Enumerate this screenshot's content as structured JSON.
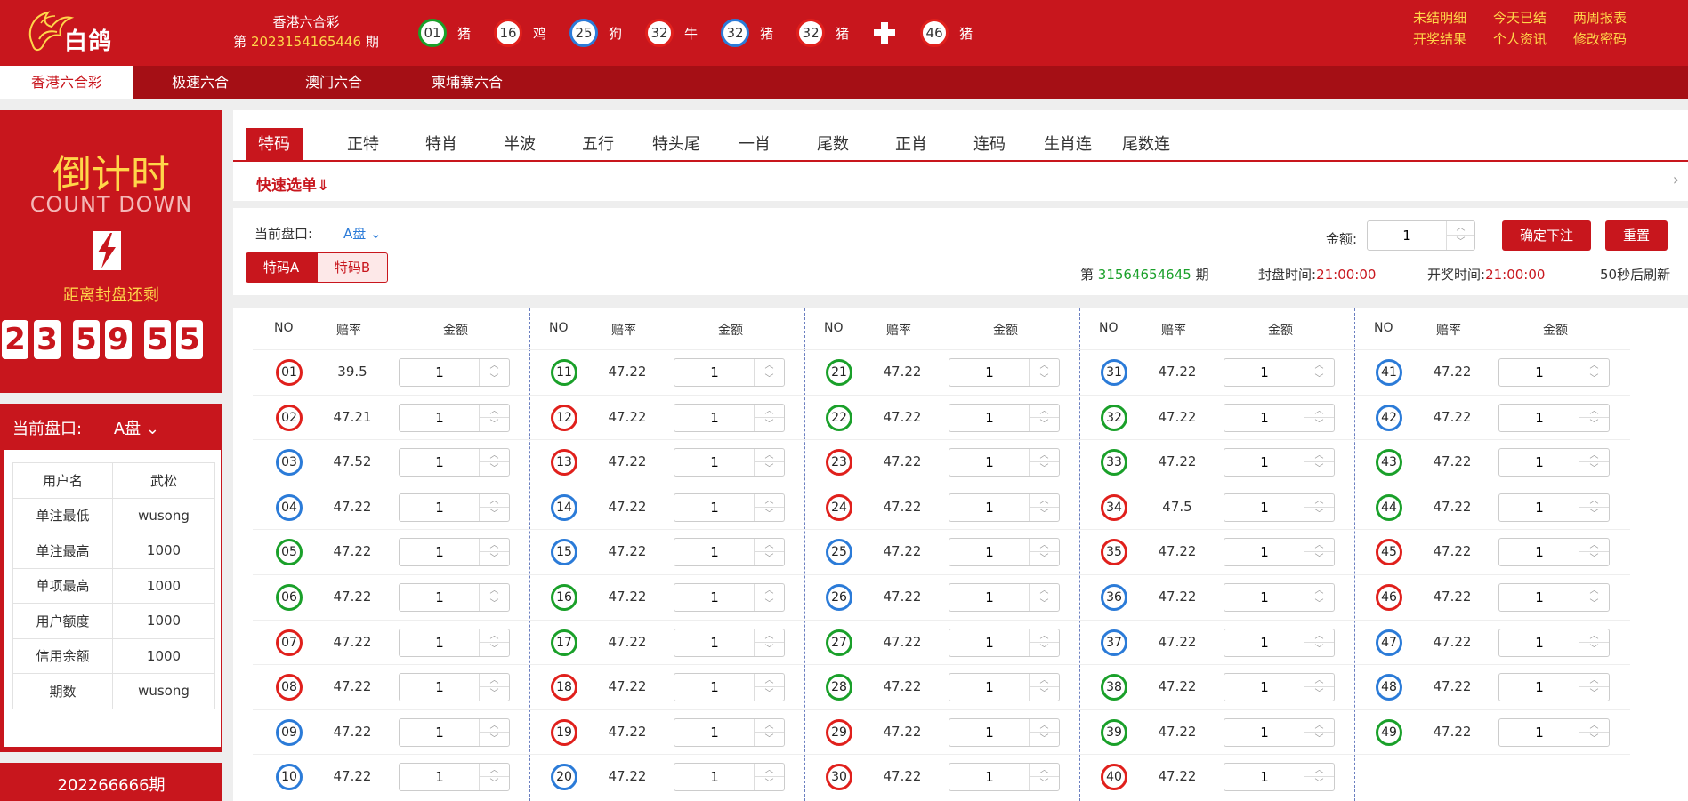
{
  "header": {
    "logo_text": "白鸽",
    "lottery_name": "香港六合彩",
    "period_prefix": "第",
    "period_number": "2023154165446",
    "period_suffix": "期",
    "draw": [
      {
        "num": "01",
        "zodiac": "猪",
        "color": "green"
      },
      {
        "num": "16",
        "zodiac": "鸡",
        "color": "red"
      },
      {
        "num": "25",
        "zodiac": "狗",
        "color": "blue"
      },
      {
        "num": "32",
        "zodiac": "牛",
        "color": "red"
      },
      {
        "num": "32",
        "zodiac": "猪",
        "color": "blue"
      },
      {
        "num": "32",
        "zodiac": "猪",
        "color": "red"
      },
      {
        "num": "46",
        "zodiac": "猪",
        "color": "red"
      }
    ],
    "links": [
      "未结明细",
      "今天已结",
      "两周报表",
      "开奖结果",
      "个人资讯",
      "修改密码"
    ]
  },
  "nav": [
    "香港六合彩",
    "极速六合",
    "澳门六合",
    "柬埔寨六合"
  ],
  "countdown": {
    "title": "倒计时",
    "subtitle": "COUNT DOWN",
    "message": "距离封盘还剩",
    "digits": [
      "2",
      "3",
      "5",
      "9",
      "5",
      "5"
    ]
  },
  "panel": {
    "label": "当前盘口:",
    "value": "A盘",
    "rows": [
      [
        "用户名",
        "武松"
      ],
      [
        "单注最低",
        "wusong"
      ],
      [
        "单注最高",
        "1000"
      ],
      [
        "单项最高",
        "1000"
      ],
      [
        "用户额度",
        "1000"
      ],
      [
        "信用余额",
        "1000"
      ],
      [
        "期数",
        "wusong"
      ]
    ],
    "footer_period": "202266666期"
  },
  "tabs": [
    "特码",
    "正特",
    "特肖",
    "半波",
    "五行",
    "特头尾",
    "一肖",
    "尾数",
    "正肖",
    "连码",
    "生肖连",
    "尾数连"
  ],
  "quick": {
    "label": "快速选单⇓"
  },
  "controls": {
    "current_label": "当前盘口:",
    "current_value": "A盘",
    "seg": [
      "特码A",
      "特码B"
    ],
    "amount_label": "金额:",
    "amount_value": "1",
    "confirm": "确定下注",
    "reset": "重置",
    "period_prefix": "第",
    "period_number": "31564654645",
    "period_suffix": "期",
    "close_label": "封盘时间:",
    "close_time": "21:00:00",
    "draw_label": "开奖时间:",
    "draw_time": "21:00:00",
    "refresh": "50秒后刷新"
  },
  "grid": {
    "headers": [
      "NO",
      "赔率",
      "金额"
    ],
    "default_amount": "1",
    "numbers": [
      {
        "n": "01",
        "o": "39.5",
        "c": "red"
      },
      {
        "n": "02",
        "o": "47.21",
        "c": "red"
      },
      {
        "n": "03",
        "o": "47.52",
        "c": "blue"
      },
      {
        "n": "04",
        "o": "47.22",
        "c": "blue"
      },
      {
        "n": "05",
        "o": "47.22",
        "c": "green"
      },
      {
        "n": "06",
        "o": "47.22",
        "c": "green"
      },
      {
        "n": "07",
        "o": "47.22",
        "c": "red"
      },
      {
        "n": "08",
        "o": "47.22",
        "c": "red"
      },
      {
        "n": "09",
        "o": "47.22",
        "c": "blue"
      },
      {
        "n": "10",
        "o": "47.22",
        "c": "blue"
      },
      {
        "n": "11",
        "o": "47.22",
        "c": "green"
      },
      {
        "n": "12",
        "o": "47.22",
        "c": "red"
      },
      {
        "n": "13",
        "o": "47.22",
        "c": "red"
      },
      {
        "n": "14",
        "o": "47.22",
        "c": "blue"
      },
      {
        "n": "15",
        "o": "47.22",
        "c": "blue"
      },
      {
        "n": "16",
        "o": "47.22",
        "c": "green"
      },
      {
        "n": "17",
        "o": "47.22",
        "c": "green"
      },
      {
        "n": "18",
        "o": "47.22",
        "c": "red"
      },
      {
        "n": "19",
        "o": "47.22",
        "c": "red"
      },
      {
        "n": "20",
        "o": "47.22",
        "c": "blue"
      },
      {
        "n": "21",
        "o": "47.22",
        "c": "green"
      },
      {
        "n": "22",
        "o": "47.22",
        "c": "green"
      },
      {
        "n": "23",
        "o": "47.22",
        "c": "red"
      },
      {
        "n": "24",
        "o": "47.22",
        "c": "red"
      },
      {
        "n": "25",
        "o": "47.22",
        "c": "blue"
      },
      {
        "n": "26",
        "o": "47.22",
        "c": "blue"
      },
      {
        "n": "27",
        "o": "47.22",
        "c": "green"
      },
      {
        "n": "28",
        "o": "47.22",
        "c": "green"
      },
      {
        "n": "29",
        "o": "47.22",
        "c": "red"
      },
      {
        "n": "30",
        "o": "47.22",
        "c": "red"
      },
      {
        "n": "31",
        "o": "47.22",
        "c": "blue"
      },
      {
        "n": "32",
        "o": "47.22",
        "c": "green"
      },
      {
        "n": "33",
        "o": "47.22",
        "c": "green"
      },
      {
        "n": "34",
        "o": "47.5",
        "c": "red"
      },
      {
        "n": "35",
        "o": "47.22",
        "c": "red"
      },
      {
        "n": "36",
        "o": "47.22",
        "c": "blue"
      },
      {
        "n": "37",
        "o": "47.22",
        "c": "blue"
      },
      {
        "n": "38",
        "o": "47.22",
        "c": "green"
      },
      {
        "n": "39",
        "o": "47.22",
        "c": "green"
      },
      {
        "n": "40",
        "o": "47.22",
        "c": "red"
      },
      {
        "n": "41",
        "o": "47.22",
        "c": "blue"
      },
      {
        "n": "42",
        "o": "47.22",
        "c": "blue"
      },
      {
        "n": "43",
        "o": "47.22",
        "c": "green"
      },
      {
        "n": "44",
        "o": "47.22",
        "c": "green"
      },
      {
        "n": "45",
        "o": "47.22",
        "c": "red"
      },
      {
        "n": "46",
        "o": "47.22",
        "c": "red"
      },
      {
        "n": "47",
        "o": "47.22",
        "c": "blue"
      },
      {
        "n": "48",
        "o": "47.22",
        "c": "blue"
      },
      {
        "n": "49",
        "o": "47.22",
        "c": "green"
      }
    ]
  },
  "colors": {
    "brand": "#c8161d",
    "nav": "#a50f15",
    "gold": "#ffd64a",
    "ball_red": "#e0201c",
    "ball_green": "#1aa02a",
    "ball_blue": "#2b7bd8"
  }
}
